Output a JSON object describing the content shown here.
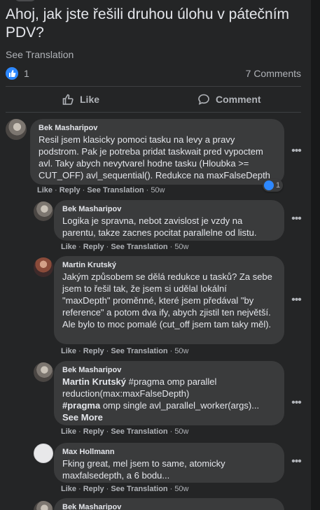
{
  "post": {
    "title": "Ahoj, jak jste řešili druhou úlohu v pátečním PDV?",
    "see_translation": "See Translation",
    "reaction_count": "1",
    "comments_count": "7 Comments"
  },
  "actions": {
    "like": "Like",
    "comment": "Comment"
  },
  "meta_labels": {
    "like": "Like",
    "reply": "Reply",
    "see_translation": "See Translation",
    "sep": "·"
  },
  "comments": [
    {
      "author": "Bek Masharipov",
      "text": "Resil jsem klasicky pomoci tasku na levy a pravy podstrom. Pak je potreba pridat taskwait pred vypoctem avl. Taky abych nevytvarel hodne tasku (Hloubka >= CUT_OFF) avl_sequential(). Redukce na maxFalseDepth",
      "time": "50w",
      "reactions": "1"
    },
    {
      "author": "Bek Masharipov",
      "text": "Logika je spravna, nebot zavislost je vzdy na parentu, takze zacnes pocitat parallelne od listu.",
      "time": "50w"
    },
    {
      "author": "Martin Krutský",
      "text": "Jakým způsobem se dělá redukce u tasků? Za sebe jsem to řešil tak, že jsem si udělal lokální \"maxDepth\" proměnné, které jsem předával \"by reference\" a potom dva ify, abych zjistil ten největší. Ale bylo to moc pomalé (cut_off jsem tam taky měl).",
      "time": "50w"
    },
    {
      "author": "Bek Masharipov",
      "mention": "Martin Krutský",
      "text_a": " #pragma omp parallel reduction(max:maxFalseDepth)",
      "bold_b": "#pragma",
      "text_b": " omp single avl_parallel_worker(args)...",
      "see_more": "See More",
      "time": "50w"
    },
    {
      "author": "Max Hollmann",
      "text": "Fking great, mel jsem to same, atomicky maxfalsedepth, a 6 bodu...",
      "time": "50w"
    },
    {
      "author": "Bek Masharipov"
    }
  ]
}
